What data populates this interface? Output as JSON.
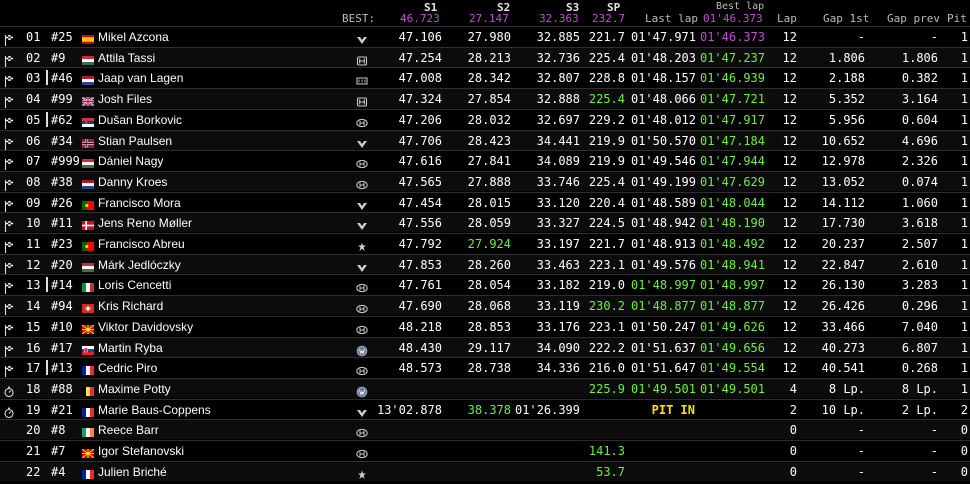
{
  "header": {
    "best_label": "BEST:",
    "s1": "S1",
    "best_s1": "46.723",
    "s2": "S2",
    "best_s2": "27.147",
    "s3": "S3",
    "best_s3": "32.363",
    "sp": "SP",
    "best_sp": "232.7",
    "last_lap": "Last lap",
    "best_lap": "Best lap",
    "best_lap_value": "01'46.373",
    "lap": "Lap",
    "gap_1st": "Gap 1st",
    "gap_prev": "Gap prev",
    "pit": "Pit"
  },
  "colors": {
    "white": "#ffffff",
    "green": "#6cf03a",
    "purple": "#c24bd6",
    "yellow": "#ffe000"
  },
  "rows": [
    {
      "pos": "01",
      "num": "#25",
      "name": "Mikel Azcona",
      "country": "es",
      "icon": "checkered-flag-icon",
      "brand": "cupra-logo",
      "s1": "47.106",
      "s1c": "w",
      "s2": "27.980",
      "s2c": "w",
      "s3": "32.885",
      "s3c": "w",
      "sp": "221.7",
      "spc": "w",
      "last": "01'47.971",
      "lastc": "w",
      "best": "01'46.373",
      "bestc": "m",
      "lap": "12",
      "gap1": "-",
      "gapp": "-",
      "pit": "1",
      "bar": false
    },
    {
      "pos": "02",
      "num": "#9",
      "name": "Attila Tassi",
      "country": "hu",
      "icon": "checkered-flag-icon",
      "brand": "honda-logo",
      "s1": "47.254",
      "s1c": "w",
      "s2": "28.213",
      "s2c": "w",
      "s3": "32.736",
      "s3c": "w",
      "sp": "225.4",
      "spc": "w",
      "last": "01'48.203",
      "lastc": "w",
      "best": "01'47.237",
      "bestc": "g",
      "lap": "12",
      "gap1": "1.806",
      "gapp": "1.806",
      "pit": "1",
      "bar": false
    },
    {
      "pos": "03",
      "num": "#46",
      "name": "Jaap van Lagen",
      "country": "nl",
      "icon": "checkered-flag-icon",
      "brand": "lynk-co-logo",
      "s1": "47.008",
      "s1c": "w",
      "s2": "28.342",
      "s2c": "w",
      "s3": "32.807",
      "s3c": "w",
      "sp": "228.8",
      "spc": "w",
      "last": "01'48.157",
      "lastc": "w",
      "best": "01'46.939",
      "bestc": "g",
      "lap": "12",
      "gap1": "2.188",
      "gapp": "0.382",
      "pit": "1",
      "bar": true
    },
    {
      "pos": "04",
      "num": "#99",
      "name": "Josh Files",
      "country": "gb",
      "icon": "checkered-flag-icon",
      "brand": "honda-logo",
      "s1": "47.324",
      "s1c": "w",
      "s2": "27.854",
      "s2c": "w",
      "s3": "32.888",
      "s3c": "w",
      "sp": "225.4",
      "spc": "g",
      "last": "01'48.066",
      "lastc": "w",
      "best": "01'47.721",
      "bestc": "g",
      "lap": "12",
      "gap1": "5.352",
      "gapp": "3.164",
      "pit": "1",
      "bar": false
    },
    {
      "pos": "05",
      "num": "#62",
      "name": "Dušan Borkovic",
      "country": "rs",
      "icon": "checkered-flag-icon",
      "brand": "hyundai-logo",
      "s1": "47.206",
      "s1c": "w",
      "s2": "28.032",
      "s2c": "w",
      "s3": "32.697",
      "s3c": "w",
      "sp": "229.2",
      "spc": "w",
      "last": "01'48.012",
      "lastc": "w",
      "best": "01'47.917",
      "bestc": "g",
      "lap": "12",
      "gap1": "5.956",
      "gapp": "0.604",
      "pit": "1",
      "bar": true
    },
    {
      "pos": "06",
      "num": "#34",
      "name": "Stian Paulsen",
      "country": "no",
      "icon": "checkered-flag-icon",
      "brand": "cupra-logo",
      "s1": "47.706",
      "s1c": "w",
      "s2": "28.423",
      "s2c": "w",
      "s3": "34.441",
      "s3c": "w",
      "sp": "219.9",
      "spc": "w",
      "last": "01'50.570",
      "lastc": "w",
      "best": "01'47.184",
      "bestc": "g",
      "lap": "12",
      "gap1": "10.652",
      "gapp": "4.696",
      "pit": "1",
      "bar": false
    },
    {
      "pos": "07",
      "num": "#999",
      "name": "Dániel Nagy",
      "country": "hu",
      "icon": "checkered-flag-icon",
      "brand": "hyundai-logo",
      "s1": "47.616",
      "s1c": "w",
      "s2": "27.841",
      "s2c": "w",
      "s3": "34.089",
      "s3c": "w",
      "sp": "219.9",
      "spc": "w",
      "last": "01'49.546",
      "lastc": "w",
      "best": "01'47.944",
      "bestc": "g",
      "lap": "12",
      "gap1": "12.978",
      "gapp": "2.326",
      "pit": "1",
      "bar": false
    },
    {
      "pos": "08",
      "num": "#38",
      "name": "Danny Kroes",
      "country": "nl",
      "icon": "checkered-flag-icon",
      "brand": "hyundai-logo",
      "s1": "47.565",
      "s1c": "w",
      "s2": "27.888",
      "s2c": "w",
      "s3": "33.746",
      "s3c": "w",
      "sp": "225.4",
      "spc": "w",
      "last": "01'49.199",
      "lastc": "w",
      "best": "01'47.629",
      "bestc": "g",
      "lap": "12",
      "gap1": "13.052",
      "gapp": "0.074",
      "pit": "1",
      "bar": false
    },
    {
      "pos": "09",
      "num": "#26",
      "name": "Francisco Mora",
      "country": "pt",
      "icon": "checkered-flag-icon",
      "brand": "cupra-logo",
      "s1": "47.454",
      "s1c": "w",
      "s2": "28.015",
      "s2c": "w",
      "s3": "33.120",
      "s3c": "w",
      "sp": "220.4",
      "spc": "w",
      "last": "01'48.589",
      "lastc": "w",
      "best": "01'48.044",
      "bestc": "g",
      "lap": "12",
      "gap1": "14.112",
      "gapp": "1.060",
      "pit": "1",
      "bar": false
    },
    {
      "pos": "10",
      "num": "#11",
      "name": "Jens Reno Møller",
      "country": "dk",
      "icon": "checkered-flag-icon",
      "brand": "cupra-logo",
      "s1": "47.556",
      "s1c": "w",
      "s2": "28.059",
      "s2c": "w",
      "s3": "33.327",
      "s3c": "w",
      "sp": "224.5",
      "spc": "w",
      "last": "01'48.942",
      "lastc": "w",
      "best": "01'48.190",
      "bestc": "g",
      "lap": "12",
      "gap1": "17.730",
      "gapp": "3.618",
      "pit": "1",
      "bar": false
    },
    {
      "pos": "11",
      "num": "#23",
      "name": "Francisco Abreu",
      "country": "pt",
      "icon": "checkered-flag-icon",
      "brand": "alfa-romeo-logo",
      "s1": "47.792",
      "s1c": "w",
      "s2": "27.924",
      "s2c": "g",
      "s3": "33.197",
      "s3c": "w",
      "sp": "221.7",
      "spc": "w",
      "last": "01'48.913",
      "lastc": "w",
      "best": "01'48.492",
      "bestc": "g",
      "lap": "12",
      "gap1": "20.237",
      "gapp": "2.507",
      "pit": "1",
      "bar": false
    },
    {
      "pos": "12",
      "num": "#20",
      "name": "Márk Jedlóczky",
      "country": "hu",
      "icon": "checkered-flag-icon",
      "brand": "cupra-logo",
      "s1": "47.853",
      "s1c": "w",
      "s2": "28.260",
      "s2c": "w",
      "s3": "33.463",
      "s3c": "w",
      "sp": "223.1",
      "spc": "w",
      "last": "01'49.576",
      "lastc": "w",
      "best": "01'48.941",
      "bestc": "g",
      "lap": "12",
      "gap1": "22.847",
      "gapp": "2.610",
      "pit": "1",
      "bar": false
    },
    {
      "pos": "13",
      "num": "#14",
      "name": "Loris Cencetti",
      "country": "it",
      "icon": "checkered-flag-icon",
      "brand": "hyundai-logo",
      "s1": "47.761",
      "s1c": "w",
      "s2": "28.054",
      "s2c": "w",
      "s3": "33.182",
      "s3c": "w",
      "sp": "219.0",
      "spc": "w",
      "last": "01'48.997",
      "lastc": "g",
      "best": "01'48.997",
      "bestc": "g",
      "lap": "12",
      "gap1": "26.130",
      "gapp": "3.283",
      "pit": "1",
      "bar": true
    },
    {
      "pos": "14",
      "num": "#94",
      "name": "Kris Richard",
      "country": "ch",
      "icon": "checkered-flag-icon",
      "brand": "hyundai-logo",
      "s1": "47.690",
      "s1c": "w",
      "s2": "28.068",
      "s2c": "w",
      "s3": "33.119",
      "s3c": "w",
      "sp": "230.2",
      "spc": "g",
      "last": "01'48.877",
      "lastc": "g",
      "best": "01'48.877",
      "bestc": "g",
      "lap": "12",
      "gap1": "26.426",
      "gapp": "0.296",
      "pit": "1",
      "bar": false
    },
    {
      "pos": "15",
      "num": "#10",
      "name": "Viktor Davidovsky",
      "country": "mk",
      "icon": "checkered-flag-icon",
      "brand": "hyundai-logo",
      "s1": "48.218",
      "s1c": "w",
      "s2": "28.853",
      "s2c": "w",
      "s3": "33.176",
      "s3c": "w",
      "sp": "223.1",
      "spc": "w",
      "last": "01'50.247",
      "lastc": "w",
      "best": "01'49.626",
      "bestc": "g",
      "lap": "12",
      "gap1": "33.466",
      "gapp": "7.040",
      "pit": "1",
      "bar": false
    },
    {
      "pos": "16",
      "num": "#17",
      "name": "Martin Ryba",
      "country": "sk",
      "icon": "checkered-flag-icon",
      "brand": "vw-logo",
      "s1": "48.430",
      "s1c": "w",
      "s2": "29.117",
      "s2c": "w",
      "s3": "34.090",
      "s3c": "w",
      "sp": "222.2",
      "spc": "w",
      "last": "01'51.637",
      "lastc": "w",
      "best": "01'49.656",
      "bestc": "g",
      "lap": "12",
      "gap1": "40.273",
      "gapp": "6.807",
      "pit": "1",
      "bar": false
    },
    {
      "pos": "17",
      "num": "#13",
      "name": "Cedric Piro",
      "country": "fr",
      "icon": "checkered-flag-icon",
      "brand": "hyundai-logo",
      "s1": "48.573",
      "s1c": "w",
      "s2": "28.738",
      "s2c": "w",
      "s3": "34.336",
      "s3c": "w",
      "sp": "216.0",
      "spc": "w",
      "last": "01'51.647",
      "lastc": "w",
      "best": "01'49.554",
      "bestc": "g",
      "lap": "12",
      "gap1": "40.541",
      "gapp": "0.268",
      "pit": "1",
      "bar": true
    },
    {
      "pos": "18",
      "num": "#88",
      "name": "Maxime Potty",
      "country": "be",
      "icon": "stopwatch-icon",
      "brand": "vw-logo",
      "s1": "",
      "s1c": "w",
      "s2": "",
      "s2c": "w",
      "s3": "",
      "s3c": "w",
      "sp": "225.9",
      "spc": "g",
      "last": "01'49.501",
      "lastc": "g",
      "best": "01'49.501",
      "bestc": "g",
      "lap": "4",
      "gap1": "8 Lp.",
      "gapp": "8 Lp.",
      "pit": "1",
      "bar": false
    },
    {
      "pos": "19",
      "num": "#21",
      "name": "Marie Baus-Coppens",
      "country": "fr",
      "icon": "stopwatch-icon",
      "brand": "cupra-logo",
      "s1": "13'02.878",
      "s1c": "w",
      "s2": "38.378",
      "s2c": "g",
      "s3": "01'26.399",
      "s3c": "w",
      "sp": "",
      "spc": "w",
      "last": "PIT IN",
      "lastc": "y",
      "best": "",
      "bestc": "g",
      "lap": "2",
      "gap1": "10 Lp.",
      "gapp": "2 Lp.",
      "pit": "2",
      "bar": false
    },
    {
      "pos": "20",
      "num": "#8",
      "name": "Reece Barr",
      "country": "ie",
      "icon": "",
      "brand": "hyundai-logo",
      "s1": "",
      "s1c": "w",
      "s2": "",
      "s2c": "w",
      "s3": "",
      "s3c": "w",
      "sp": "",
      "spc": "w",
      "last": "",
      "lastc": "w",
      "best": "",
      "bestc": "g",
      "lap": "0",
      "gap1": "-",
      "gapp": "-",
      "pit": "0",
      "bar": false
    },
    {
      "pos": "21",
      "num": "#7",
      "name": "Igor Stefanovski",
      "country": "mk",
      "icon": "",
      "brand": "hyundai-logo",
      "s1": "",
      "s1c": "w",
      "s2": "",
      "s2c": "w",
      "s3": "",
      "s3c": "w",
      "sp": "141.3",
      "spc": "g",
      "last": "",
      "lastc": "w",
      "best": "",
      "bestc": "g",
      "lap": "0",
      "gap1": "-",
      "gapp": "-",
      "pit": "0",
      "bar": false
    },
    {
      "pos": "22",
      "num": "#4",
      "name": "Julien Briché",
      "country": "fr",
      "icon": "",
      "brand": "alfa-romeo-logo",
      "s1": "",
      "s1c": "w",
      "s2": "",
      "s2c": "w",
      "s3": "",
      "s3c": "w",
      "sp": "53.7",
      "spc": "g",
      "last": "",
      "lastc": "w",
      "best": "",
      "bestc": "g",
      "lap": "0",
      "gap1": "-",
      "gapp": "-",
      "pit": "0",
      "bar": false
    }
  ]
}
